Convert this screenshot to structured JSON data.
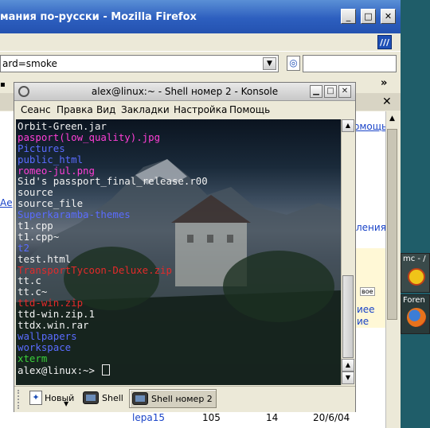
{
  "firefox": {
    "title": "мания по-русски - Mozilla Firefox",
    "url": "ard=smoke",
    "bookmarks_chevron": "»",
    "content_fragments": {
      "help_link": "омощь",
      "ae_link": "Ае",
      "changes_link": "ления",
      "new_badge": "вое",
      "link_1": "иее",
      "link_2": "ие",
      "author": "lepa15",
      "views": "105",
      "replies": "14",
      "date": "20/6/04"
    }
  },
  "taskbar": {
    "mc_label": "mc - /",
    "firefox_label": "Foren"
  },
  "konsole": {
    "title": "alex@linux:~ - Shell номер 2 - Konsole",
    "menu": [
      "Сеанс",
      "Правка",
      "Вид",
      "Закладки",
      "Настройка",
      "Помощь"
    ],
    "lines": [
      {
        "text": "Orbit-Green.jar",
        "color": "white"
      },
      {
        "text": "pasport(low_quality).jpg",
        "color": "magenta"
      },
      {
        "text": "Pictures",
        "color": "blue"
      },
      {
        "text": "public_html",
        "color": "blue"
      },
      {
        "text": "romeo-jul.png",
        "color": "magenta"
      },
      {
        "text": "Sid's passport_final_release.r00",
        "color": "white"
      },
      {
        "text": "source",
        "color": "white"
      },
      {
        "text": "source_file",
        "color": "white"
      },
      {
        "text": "Superkaramba-themes",
        "color": "blue"
      },
      {
        "text": "t1.cpp",
        "color": "white"
      },
      {
        "text": "t1.cpp~",
        "color": "white"
      },
      {
        "text": "t2",
        "color": "blue"
      },
      {
        "text": "test.html",
        "color": "white"
      },
      {
        "text": "TransportTycoon-Deluxe.zip",
        "color": "red"
      },
      {
        "text": "tt.c",
        "color": "white"
      },
      {
        "text": "tt.c~",
        "color": "white"
      },
      {
        "text": "ttd-win.zip",
        "color": "red"
      },
      {
        "text": "ttd-win.zip.1",
        "color": "white"
      },
      {
        "text": "ttdx.win.rar",
        "color": "white"
      },
      {
        "text": "wallpapers",
        "color": "blue"
      },
      {
        "text": "workspace",
        "color": "blue"
      },
      {
        "text": "xterm",
        "color": "green"
      },
      {
        "text": "alex@linux:~> ",
        "color": "white"
      }
    ],
    "tabs": {
      "new_label": "Новый",
      "shell_label": "Shell",
      "shell2_label": "Shell номер 2"
    },
    "colors": {
      "white": "#f2f2f2",
      "magenta": "#ff3fd6",
      "blue": "#5a6cff",
      "red": "#e42a2a",
      "green": "#3ad03a"
    }
  }
}
